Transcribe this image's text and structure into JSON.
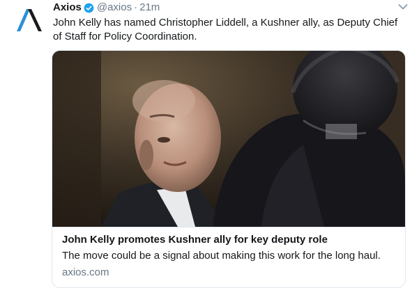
{
  "tweet": {
    "author_name": "Axios",
    "handle": "@axios",
    "separator": "·",
    "time": "21m",
    "text": "John Kelly has named Christopher Liddell, a Kushner ally, as Deputy Chief of Staff for Policy Coordination.",
    "icons": {
      "avatar": "axios-logo-icon",
      "verified": "verified-badge-icon",
      "menu": "chevron-down-icon"
    }
  },
  "card": {
    "title": "John Kelly promotes Kushner ally for key deputy role",
    "description": "The move could be a signal about making this work for the long haul.",
    "domain": "axios.com"
  },
  "colors": {
    "verified": "#1da1f2",
    "secondary_text": "#657786",
    "avatar_blue": "#2c8fd6",
    "avatar_black": "#1b1b1b"
  }
}
